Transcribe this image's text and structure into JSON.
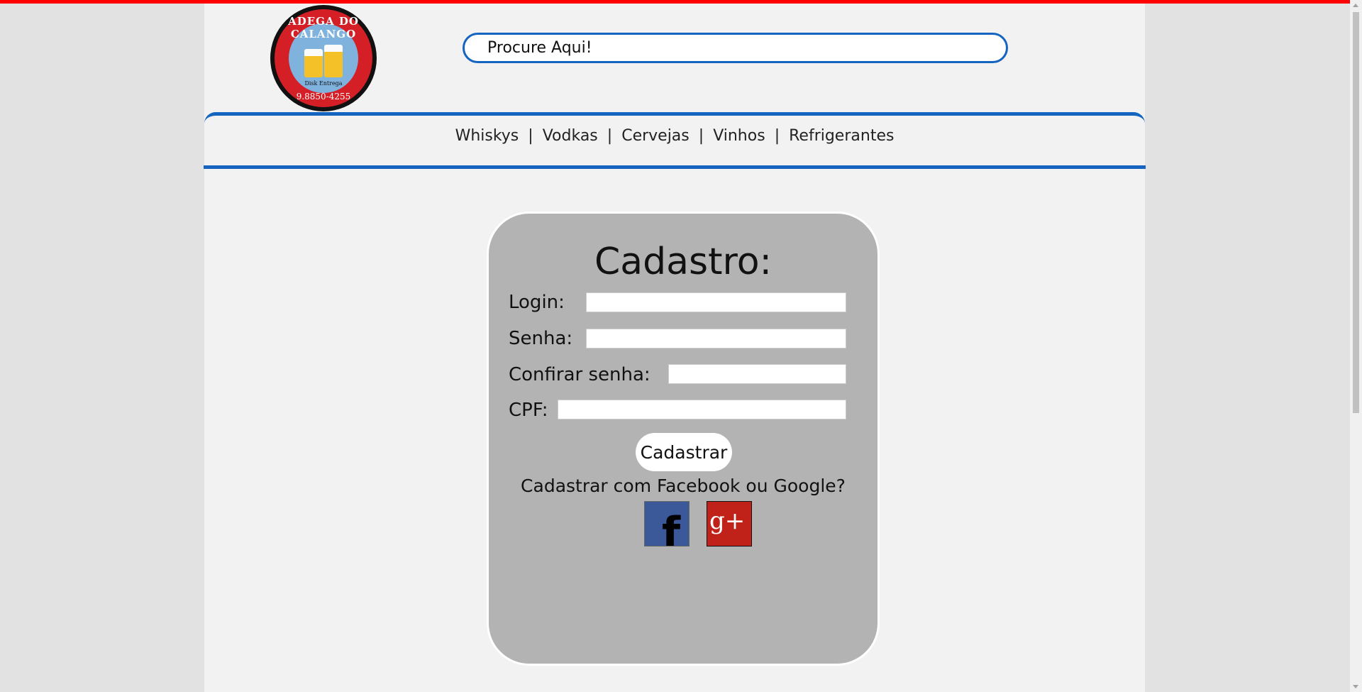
{
  "header": {
    "logo": {
      "name": "ADEGA DO CALANGO",
      "tagline": "Disk Entrega",
      "phone": "9.8850-4255"
    },
    "search": {
      "placeholder": "Procure Aqui!"
    }
  },
  "nav": {
    "items": [
      {
        "label": "Whiskys"
      },
      {
        "label": "Vodkas"
      },
      {
        "label": "Cervejas"
      },
      {
        "label": "Vinhos"
      },
      {
        "label": "Refrigerantes"
      }
    ],
    "separator": "|"
  },
  "form": {
    "title": "Cadastro:",
    "fields": {
      "login_label": "Login:",
      "senha_label": "Senha:",
      "confirmar_label": "Confirar senha:",
      "cpf_label": "CPF:"
    },
    "submit_label": "Cadastrar",
    "social_question": "Cadastrar com Facebook ou Google?",
    "social": {
      "facebook_glyph": "f",
      "google_glyph": "g+"
    }
  },
  "colors": {
    "top_bar": "#ff0000",
    "accent_blue": "#1565c0",
    "panel": "#b3b3b3",
    "page_bg": "#f2f2f2"
  },
  "icons": [
    "facebook-icon",
    "google-plus-icon"
  ]
}
